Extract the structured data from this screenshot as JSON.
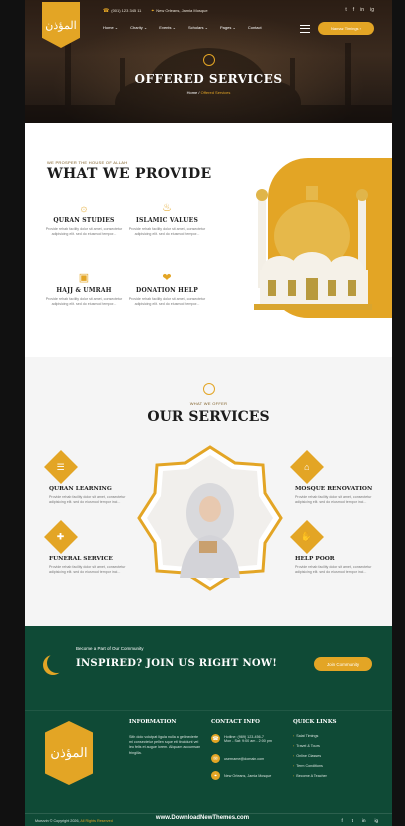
{
  "logo": {
    "text": "المؤذن"
  },
  "topbar": {
    "phone": "(001) 123 345 11",
    "address": "New Orleans, Jamia Mosque"
  },
  "social": [
    "t",
    "f",
    "in",
    "ig"
  ],
  "nav": [
    "Home ⌄",
    "Charity ⌄",
    "Events ⌄",
    "Scholars ⌄",
    "Pages ⌄",
    "Contact"
  ],
  "header": {
    "timings_button": "Namaz Timings"
  },
  "hero": {
    "title": "OFFERED SERVICES",
    "crumb_home": "Home",
    "crumb_sep": "/",
    "crumb_current": "Offered Services"
  },
  "provide": {
    "eyebrow": "WE PROSPER THE HOUSE OF ALLAH",
    "title": "WHAT WE PROVIDE",
    "features": [
      {
        "icon": "quran-icon",
        "glyph": "۞",
        "title": "QURAN STUDIES",
        "text": "Provide rehab facility dolor sit amet, consectetur adipisicing elit. sed do eiusmod tempor..."
      },
      {
        "icon": "lantern-icon",
        "glyph": "♨",
        "title": "ISLAMIC VALUES",
        "text": "Provide rehab facility dolor sit amet, consectetur adipisicing elit. sed do eiusmod tempor..."
      },
      {
        "icon": "kaaba-icon",
        "glyph": "▣",
        "title": "HAJJ & UMRAH",
        "text": "Provide rehab facility dolor sit amet, consectetur adipisicing elit. sed do eiusmod tempor..."
      },
      {
        "icon": "donation-icon",
        "glyph": "❤",
        "title": "DONATION HELP",
        "text": "Provide rehab facility dolor sit amet, consectetur adipisicing elit. sed do eiusmod tempor..."
      }
    ]
  },
  "services": {
    "eyebrow": "WHAT WE OFFER",
    "title": "OUR SERVICES",
    "items": [
      {
        "icon": "quran-icon",
        "glyph": "☰",
        "title": "QURAN LEARNING",
        "text": "Provide rehab facility dolor sit amet, consectetur adipisicing elit. sed do eiusmod tempor inci..."
      },
      {
        "icon": "mosque-icon",
        "glyph": "⌂",
        "title": "MOSQUE RENOVATION",
        "text": "Provide rehab facility dolor sit amet, consectetur adipisicing elit. sed do eiusmod tempor inci..."
      },
      {
        "icon": "funeral-icon",
        "glyph": "✚",
        "title": "FUNERAL SERVICE",
        "text": "Provide rehab facility dolor sit amet, consectetur adipisicing elit. sed do eiusmod tempor inci..."
      },
      {
        "icon": "help-icon",
        "glyph": "✋",
        "title": "HELP POOR",
        "text": "Provide rehab facility dolor sit amet, consectetur adipisicing elit. sed do eiusmod tempor inci..."
      }
    ]
  },
  "cta": {
    "small": "Become a Part of Our Community",
    "big": "INSPIRED? JOIN US RIGHT NOW!",
    "button": "Join Community"
  },
  "footer": {
    "logo_text": "المؤذن",
    "info_title": "INFORMATION",
    "info_text": "Sith dolo volutpat ligula nulla a gelinederte mi consectetur pellen sque eti tincidunt vel leo felis et augue lorem. Aliquam accumsan fringilla.",
    "contact_title": "CONTACT INFO",
    "contacts": [
      {
        "icon": "phone-icon",
        "glyph": "☎",
        "text": "Hotline: (989) 123-456-7",
        "sub": "Mon - Sat: 9:00 am - 2:00 pm"
      },
      {
        "icon": "mail-icon",
        "glyph": "✉",
        "text": "username@domain.com",
        "sub": ""
      },
      {
        "icon": "location-icon",
        "glyph": "⌖",
        "text": "New Orleans, Jamia Mosque",
        "sub": ""
      }
    ],
    "links_title": "QUICK LINKS",
    "links": [
      "Salat Timings",
      "Travel & Tours",
      "Online Classes",
      "Term Conditions",
      "Become A Teacher"
    ],
    "copyright_prefix": "Muezzin © Copyright 2026,",
    "copyright_hl": "All Rights Reserved"
  },
  "watermark": "www.DownloadNewThemes.com"
}
